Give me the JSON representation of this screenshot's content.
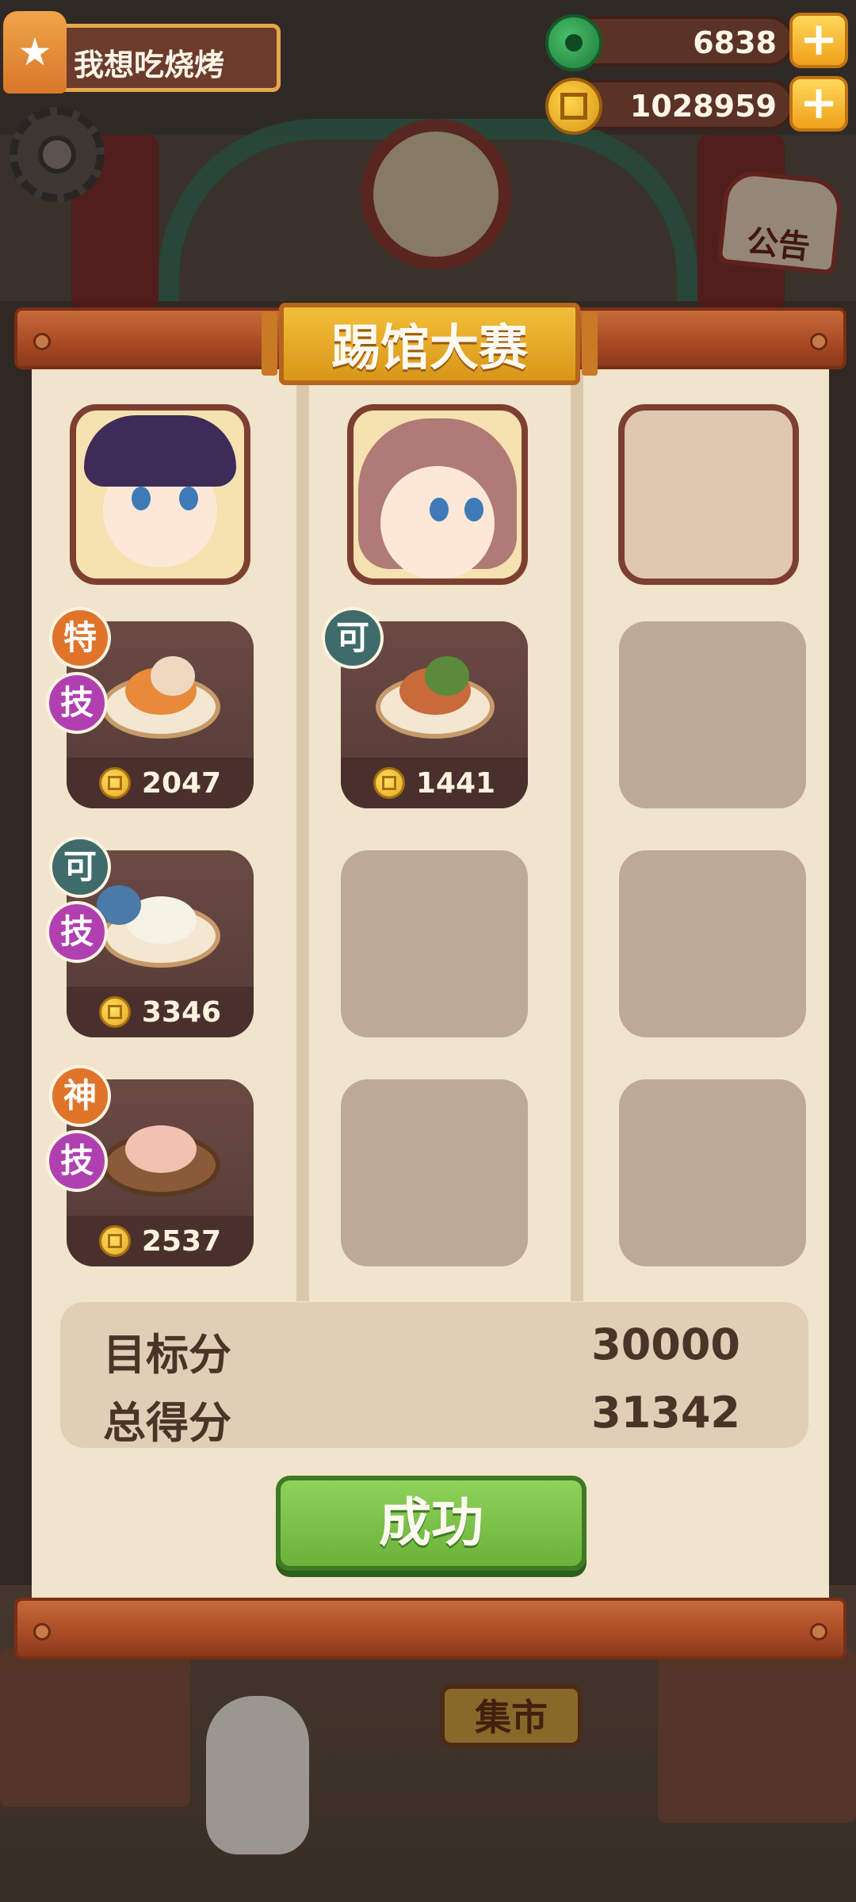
{
  "hud": {
    "player_name": "我想吃烧烤",
    "gems": "6838",
    "coins": "1028959",
    "plus": "+"
  },
  "background": {
    "notice_label": "公告",
    "market_label": "集市"
  },
  "modal": {
    "title": "踢馆大赛",
    "columns": [
      {
        "portrait": "chef-official",
        "dishes": [
          {
            "grade": "特",
            "skill": "技",
            "price": "2047",
            "icon": "crab-feast"
          },
          {
            "grade": "可",
            "skill": "技",
            "price": "3346",
            "icon": "peacock-noodles"
          },
          {
            "grade": "神",
            "skill": "技",
            "price": "2537",
            "icon": "meatball-bowl"
          }
        ]
      },
      {
        "portrait": "chef-girl",
        "dishes": [
          {
            "grade": "可",
            "price": "1441",
            "icon": "roast-platter"
          }
        ]
      },
      {
        "portrait": "empty",
        "dishes": []
      }
    ],
    "score": {
      "target_label": "目标分",
      "target_value": "30000",
      "total_label": "总得分",
      "total_value": "31342"
    },
    "result_button": "成功"
  }
}
